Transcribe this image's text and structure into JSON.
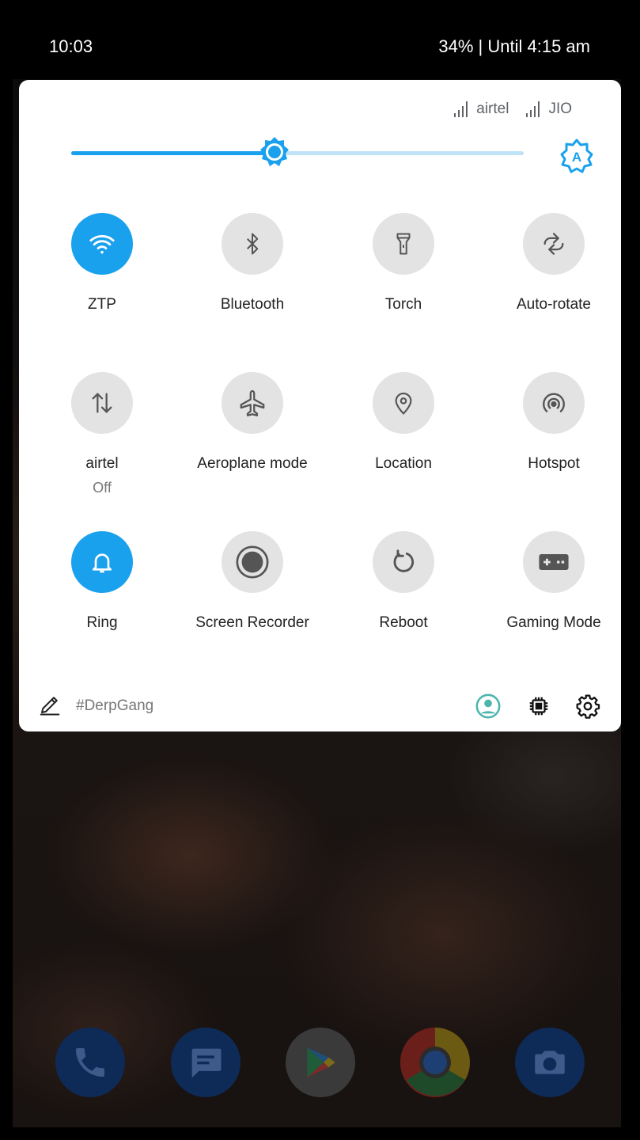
{
  "status_bar": {
    "time": "10:03",
    "battery": "34% | Until 4:15 am"
  },
  "carriers": [
    {
      "name": "airtel"
    },
    {
      "name": "JIO"
    }
  ],
  "brightness": {
    "level": 0.45
  },
  "tiles": [
    {
      "label": "ZTP",
      "icon": "wifi-icon",
      "active": true
    },
    {
      "label": "Bluetooth",
      "icon": "bluetooth-icon",
      "active": false
    },
    {
      "label": "Torch",
      "icon": "torch-icon",
      "active": false
    },
    {
      "label": "Auto-rotate",
      "icon": "auto-rotate-icon",
      "active": false
    },
    {
      "label": "airtel",
      "sub": "Off",
      "icon": "mobile-data-icon",
      "active": false
    },
    {
      "label": "Aeroplane mode",
      "icon": "airplane-icon",
      "active": false
    },
    {
      "label": "Location",
      "icon": "location-icon",
      "active": false
    },
    {
      "label": "Hotspot",
      "icon": "hotspot-icon",
      "active": false
    },
    {
      "label": "Ring",
      "icon": "bell-icon",
      "active": true
    },
    {
      "label": "Screen Recorder",
      "icon": "record-icon",
      "active": false
    },
    {
      "label": "Reboot",
      "icon": "reboot-icon",
      "active": false
    },
    {
      "label": "Gaming Mode",
      "icon": "gamepad-icon",
      "active": false
    }
  ],
  "footer": {
    "text": "#DerpGang"
  },
  "colors": {
    "accent": "#1aa1ee",
    "tile_off": "#e3e3e3",
    "panel_bg": "#ffffff"
  },
  "dock": [
    {
      "icon": "phone-icon"
    },
    {
      "icon": "messages-icon"
    },
    {
      "icon": "play-store-icon"
    },
    {
      "icon": "chrome-icon"
    },
    {
      "icon": "camera-icon"
    }
  ]
}
